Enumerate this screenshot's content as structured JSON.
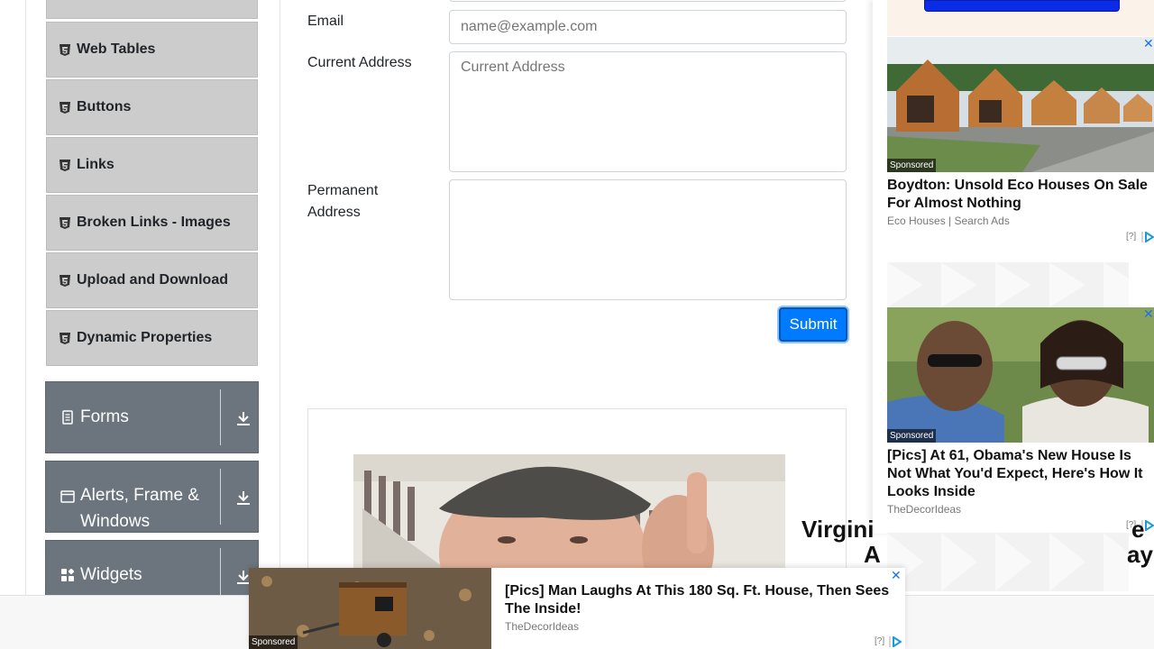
{
  "sidebar": {
    "items": [
      {
        "label": ""
      },
      {
        "label": "Web Tables"
      },
      {
        "label": "Buttons"
      },
      {
        "label": "Links"
      },
      {
        "label": "Broken Links - Images"
      },
      {
        "label": "Upload and Download"
      },
      {
        "label": "Dynamic Properties"
      }
    ],
    "groups": [
      {
        "label": "Forms",
        "icon": "document-icon"
      },
      {
        "label": "Alerts, Frame &",
        "label2": "Windows",
        "icon": "window-icon"
      },
      {
        "label": "Widgets",
        "icon": "widgets-icon"
      }
    ]
  },
  "form": {
    "email_label": "Email",
    "email_placeholder": "name@example.com",
    "current_address_label": "Current Address",
    "current_address_placeholder": "Current Address",
    "permanent_address_label_1": "Permanent",
    "permanent_address_label_2": "Address",
    "submit_label": "Submit"
  },
  "ads": {
    "right": [
      {
        "sponsored": "Sponsored",
        "title": "Boydton: Unsold Eco Houses On Sale For Almost Nothing",
        "source": "Eco Houses | Search Ads",
        "adchoice": "[?]"
      },
      {
        "sponsored": "Sponsored",
        "title": "[Pics] At 61, Obama's New House Is Not What You'd Expect, Here's How It Looks Inside",
        "source": "TheDecorIdeas",
        "adchoice": "[?]"
      }
    ],
    "center": {
      "text_line1": "Virgini",
      "text_line2": "A",
      "text_line1_end": "e",
      "text_line2_end": "ay"
    },
    "bottom": {
      "sponsored": "Sponsored",
      "title": "[Pics] Man Laughs At This 180 Sq. Ft. House, Then Sees The Inside!",
      "source": "TheDecorIdeas",
      "adchoice": "[?]"
    }
  },
  "colors": {
    "accent": "#007bff",
    "menu_item_bg": "#cccccc",
    "group_bg": "#6c757d"
  }
}
